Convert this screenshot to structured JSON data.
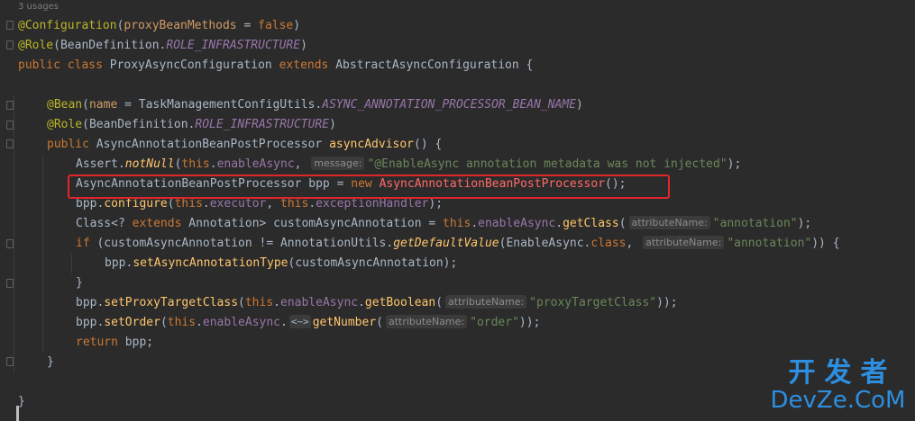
{
  "editor": {
    "usages": "3 usages",
    "lines": {
      "l1": {
        "a": "@Configuration",
        "b": "(",
        "c": "proxyBeanMethods",
        "d": " = ",
        "e": "false",
        "f": ")"
      },
      "l2": {
        "a": "@Role",
        "b": "(BeanDefinition.",
        "c": "ROLE_INFRASTRUCTURE",
        "d": ")"
      },
      "l3": {
        "a": "public class ",
        "b": "ProxyAsyncConfiguration ",
        "c": "extends ",
        "d": "AbstractAsyncConfiguration {"
      },
      "l5": {
        "a": "@Bean",
        "b": "(",
        "c": "name",
        "d": " = TaskManagementConfigUtils.",
        "e": "ASYNC_ANNOTATION_PROCESSOR_BEAN_NAME",
        "f": ")"
      },
      "l6": {
        "a": "@Role",
        "b": "(BeanDefinition.",
        "c": "ROLE_INFRASTRUCTURE",
        "d": ")"
      },
      "l7": {
        "a": "public ",
        "b": "AsyncAnnotationBeanPostProcessor ",
        "c": "asyncAdvisor",
        "d": "() {"
      },
      "l8": {
        "a": "Assert.",
        "b": "notNull",
        "c": "(",
        "d": "this",
        "e": ".",
        "f": "enableAsync",
        "g": ", ",
        "h": "message:",
        "i": "\"@EnableAsync annotation metadata was not injected\"",
        "j": ");"
      },
      "l9": {
        "a": "AsyncAnnotationBeanPostProcessor bpp = ",
        "b": "new ",
        "c": "AsyncAnnotationBeanPostProcessor",
        "d": "();"
      },
      "l10": {
        "a": "bpp.",
        "b": "configure",
        "c": "(",
        "d": "this",
        "e": ".",
        "f": "executor",
        "g": ", ",
        "h": "this",
        "i": ".",
        "j": "exceptionHandler",
        "k": ");"
      },
      "l11": {
        "a": "Class<? ",
        "b": "extends ",
        "c": "Annotation> customAsyncAnnotation = ",
        "d": "this",
        "e": ".",
        "f": "enableAsync",
        "g": ".",
        "h": "getClass",
        "i": "(",
        "j": "attributeName:",
        "k": "\"annotation\"",
        "l": ");"
      },
      "l12": {
        "a": "if ",
        "b": "(customAsyncAnnotation != AnnotationUtils.",
        "c": "getDefaultValue",
        "d": "(EnableAsync.",
        "e": "class",
        "f": ", ",
        "g": "attributeName:",
        "h": "\"annotation\"",
        "i": ")) {"
      },
      "l13": {
        "a": "bpp.",
        "b": "setAsyncAnnotationType",
        "c": "(customAsyncAnnotation);"
      },
      "l14": {
        "a": "}"
      },
      "l15": {
        "a": "bpp.",
        "b": "setProxyTargetClass",
        "c": "(",
        "d": "this",
        "e": ".",
        "f": "enableAsync",
        "g": ".",
        "h": "getBoolean",
        "i": "(",
        "j": "attributeName:",
        "k": "\"proxyTargetClass\"",
        "l": "));"
      },
      "l16": {
        "a": "bpp.",
        "b": "setOrder",
        "c": "(",
        "d": "this",
        "e": ".",
        "f": "enableAsync",
        "g": ".",
        "h": "<~>",
        "i": "getNumber",
        "j": "(",
        "k": "attributeName:",
        "l": "\"order\"",
        "m": "));"
      },
      "l17": {
        "a": "return ",
        "b": "bpp;"
      },
      "l18": {
        "a": "}"
      },
      "l20": {
        "a": "}"
      }
    }
  },
  "watermark": {
    "cn": "开发者",
    "en": "DevZe.CoM"
  },
  "colors": {
    "background": "#2b2b2b",
    "highlight_border": "#e0262b",
    "watermark": "#2d8fe0"
  }
}
